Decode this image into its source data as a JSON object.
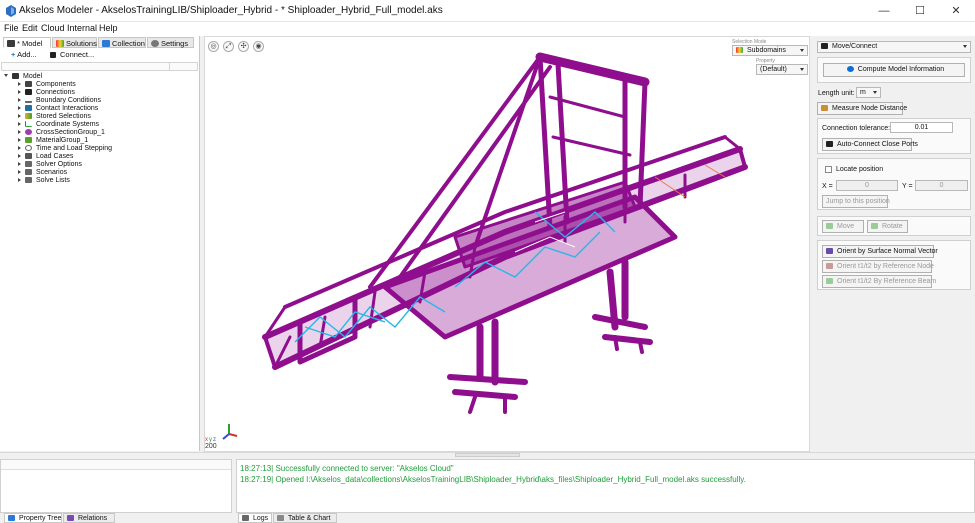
{
  "window": {
    "title": "Akselos Modeler - AkselosTrainingLIB/Shiploader_Hybrid - * Shiploader_Hybrid_Full_model.aks",
    "minimize": "—",
    "maximize": "☐",
    "close": "✕"
  },
  "menu": [
    "File",
    "Edit",
    "Cloud",
    "Internal",
    "Help"
  ],
  "left_tabs": [
    {
      "label": "* Model",
      "icon": "model-icon"
    },
    {
      "label": "Solutions",
      "icon": "solutions-icon"
    },
    {
      "label": "Collection",
      "icon": "collection-icon"
    },
    {
      "label": "Settings",
      "icon": "settings-icon"
    }
  ],
  "toolbar": {
    "add": "Add...",
    "connect": "Connect..."
  },
  "tree": {
    "root": "Model",
    "items": [
      "Components",
      "Connections",
      "Boundary Conditions",
      "Contact Interactions",
      "Stored Selections",
      "Coordinate Systems",
      "CrossSectionGroup_1",
      "MaterialGroup_1",
      "Time and Load Stepping",
      "Load Cases",
      "Solver Options",
      "Scenarios",
      "Solve Lists"
    ]
  },
  "viewport": {
    "selection_mode_label": "Selection Mode",
    "selection_mode": "Subdomains",
    "property_label": "Property",
    "property": "(Default)",
    "axis_scale": "200",
    "axis_labels": {
      "x": "x",
      "y": "y",
      "z": "z"
    }
  },
  "right_panel": {
    "tool": "Move/Connect",
    "compute_button": "Compute Model Information",
    "length_unit_label": "Length unit:",
    "length_unit": "m",
    "measure_button": "Measure Node Distance",
    "tolerance_label": "Connection tolerance:",
    "tolerance_value": "0.01",
    "auto_connect_button": "Auto-Connect Close Ports",
    "locate_label": "Locate position",
    "x_label": "X =",
    "x_value": "0",
    "y_label": "Y =",
    "y_value": "0",
    "jump_button": "Jump to this position",
    "move_button": "Move",
    "rotate_button": "Rotate",
    "orient_normal_button": "Orient by Surface Normal Vector",
    "orient_ref_node_button": "Orient t1/t2 by Reference Node",
    "orient_ref_beam_button": "Orient t1/t2 By Reference Beam"
  },
  "log": [
    "18:27:13| Successfully connected to server: \"Akselos Cloud\"",
    "18:27:19| Opened I:\\Akselos_data\\collections\\AkselosTrainingLIB\\Shiploader_Hybrid\\aks_files\\Shiploader_Hybrid_Full_model.aks successfully."
  ],
  "bottom_tabs": {
    "property_tree": "Property Tree",
    "relations": "Relations",
    "logs": "Logs",
    "table_chart": "Table & Chart"
  },
  "colors": {
    "structure": "#8e0e8e",
    "members": "#29b6e8",
    "accent": "#0a6fd6",
    "log_text": "#1f9d3a"
  }
}
